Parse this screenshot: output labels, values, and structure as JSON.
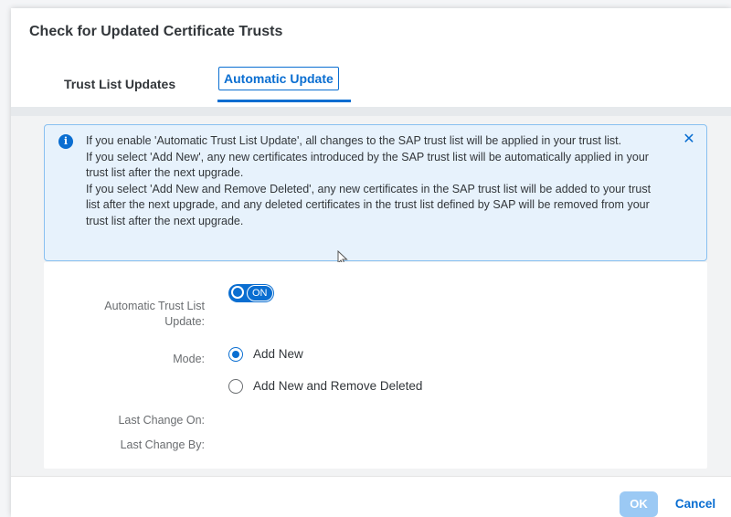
{
  "dialog": {
    "title": "Check for Updated Certificate Trusts"
  },
  "tabs": [
    {
      "label": "Trust List Updates",
      "selected": false
    },
    {
      "label": "Automatic Update",
      "selected": true
    }
  ],
  "info_strip": {
    "icon": "info-icon",
    "close_icon": "close-icon",
    "close_symbol": "✕",
    "lines": [
      "If you enable 'Automatic Trust List Update', all changes to the SAP trust list will be applied in your trust list.",
      "If you select 'Add New', any new certificates introduced by the SAP trust list will be automatically applied in your trust list after the next upgrade.",
      "If you select 'Add New and Remove Deleted', any new certificates in the SAP trust list will be added to your trust list after the next upgrade, and any deleted certificates in the trust list defined by SAP will be removed from your trust list after the next upgrade."
    ]
  },
  "form": {
    "auto_update_label_line1": "Automatic Trust List",
    "auto_update_label_line2": "Update:",
    "toggle_text": "ON",
    "toggle_on": true,
    "mode_label": "Mode:",
    "mode_options": [
      {
        "label": "Add New",
        "checked": true
      },
      {
        "label": "Add New and Remove Deleted",
        "checked": false
      }
    ],
    "last_change_on_label": "Last Change On:",
    "last_change_on_value": "",
    "last_change_by_label": "Last Change By:",
    "last_change_by_value": ""
  },
  "footer": {
    "ok_label": "OK",
    "cancel_label": "Cancel"
  },
  "colors": {
    "accent": "#0a6ed1",
    "info_background": "#e7f2fc",
    "info_border": "#89c0f0",
    "ok_disabled": "#9bc9f4"
  }
}
